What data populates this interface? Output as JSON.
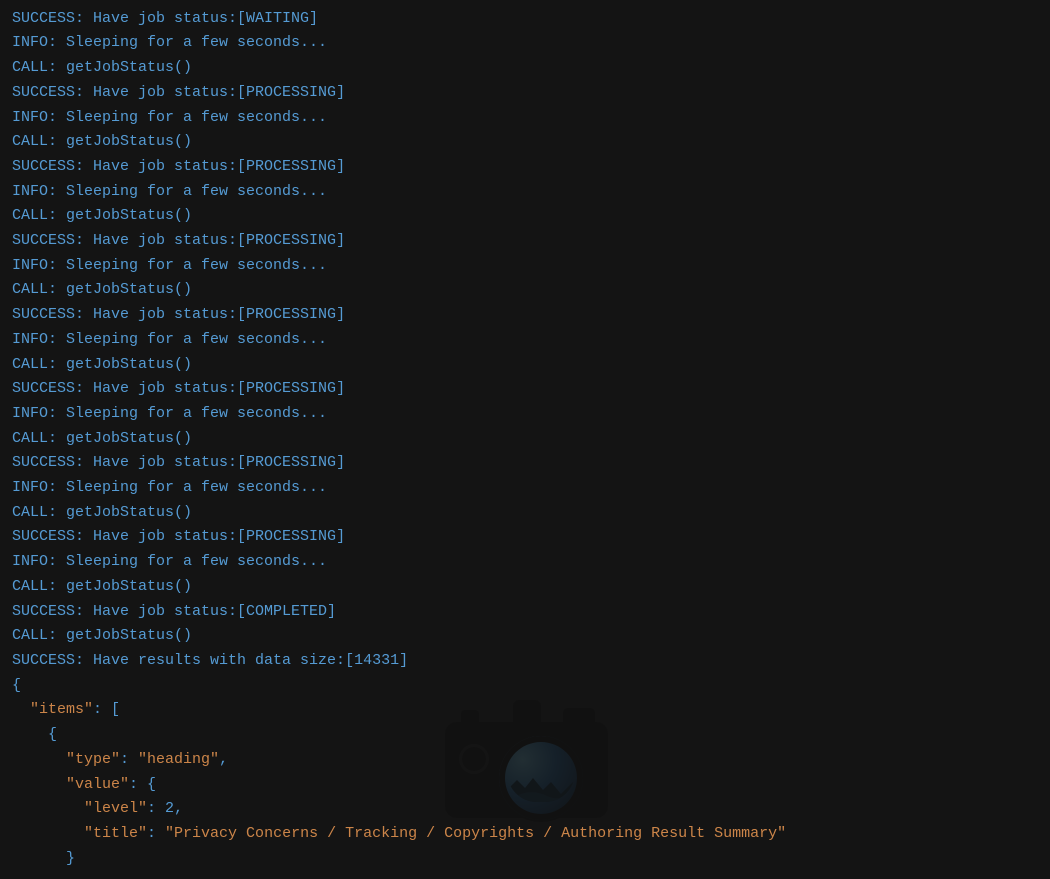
{
  "strings": {
    "call": "CALL: ",
    "fn": "getJobStatus()",
    "success": "SUCCESS: ",
    "jobstatus": "Have job status:",
    "waiting": "[WAITING]",
    "processing": "[PROCESSING]",
    "completed": "[COMPLETED]",
    "results": "Have results with data size:",
    "size": "[14331]",
    "info": "INFO: ",
    "sleep": "Sleeping for a few seconds..."
  },
  "json_output": {
    "l1": "{",
    "l2_a": "  \"items\"",
    "l2_b": ": [",
    "l3": "    {",
    "l4_a": "      \"type\"",
    "l4_b": ": ",
    "l4_c": "\"heading\"",
    "l4_d": ",",
    "l5_a": "      \"value\"",
    "l5_b": ": {",
    "l6_a": "        \"level\"",
    "l6_b": ": ",
    "l6_c": "2",
    "l6_d": ",",
    "l7_a": "        \"title\"",
    "l7_b": ": ",
    "l7_c": "\"Privacy Concerns / Tracking / Copyrights / Authoring Result Summary\"",
    "l8": "      }"
  },
  "log": [
    {
      "t": "call_partial"
    },
    {
      "t": "status",
      "v": "waiting"
    },
    {
      "t": "sleep"
    },
    {
      "t": "call"
    },
    {
      "t": "status",
      "v": "processing"
    },
    {
      "t": "sleep"
    },
    {
      "t": "call"
    },
    {
      "t": "status",
      "v": "processing"
    },
    {
      "t": "sleep"
    },
    {
      "t": "call"
    },
    {
      "t": "status",
      "v": "processing"
    },
    {
      "t": "sleep"
    },
    {
      "t": "call"
    },
    {
      "t": "status",
      "v": "processing"
    },
    {
      "t": "sleep"
    },
    {
      "t": "call"
    },
    {
      "t": "status",
      "v": "processing"
    },
    {
      "t": "sleep"
    },
    {
      "t": "call"
    },
    {
      "t": "status",
      "v": "processing"
    },
    {
      "t": "sleep"
    },
    {
      "t": "call"
    },
    {
      "t": "status",
      "v": "processing"
    },
    {
      "t": "sleep"
    },
    {
      "t": "call"
    },
    {
      "t": "status",
      "v": "completed"
    },
    {
      "t": "call"
    },
    {
      "t": "results"
    }
  ]
}
